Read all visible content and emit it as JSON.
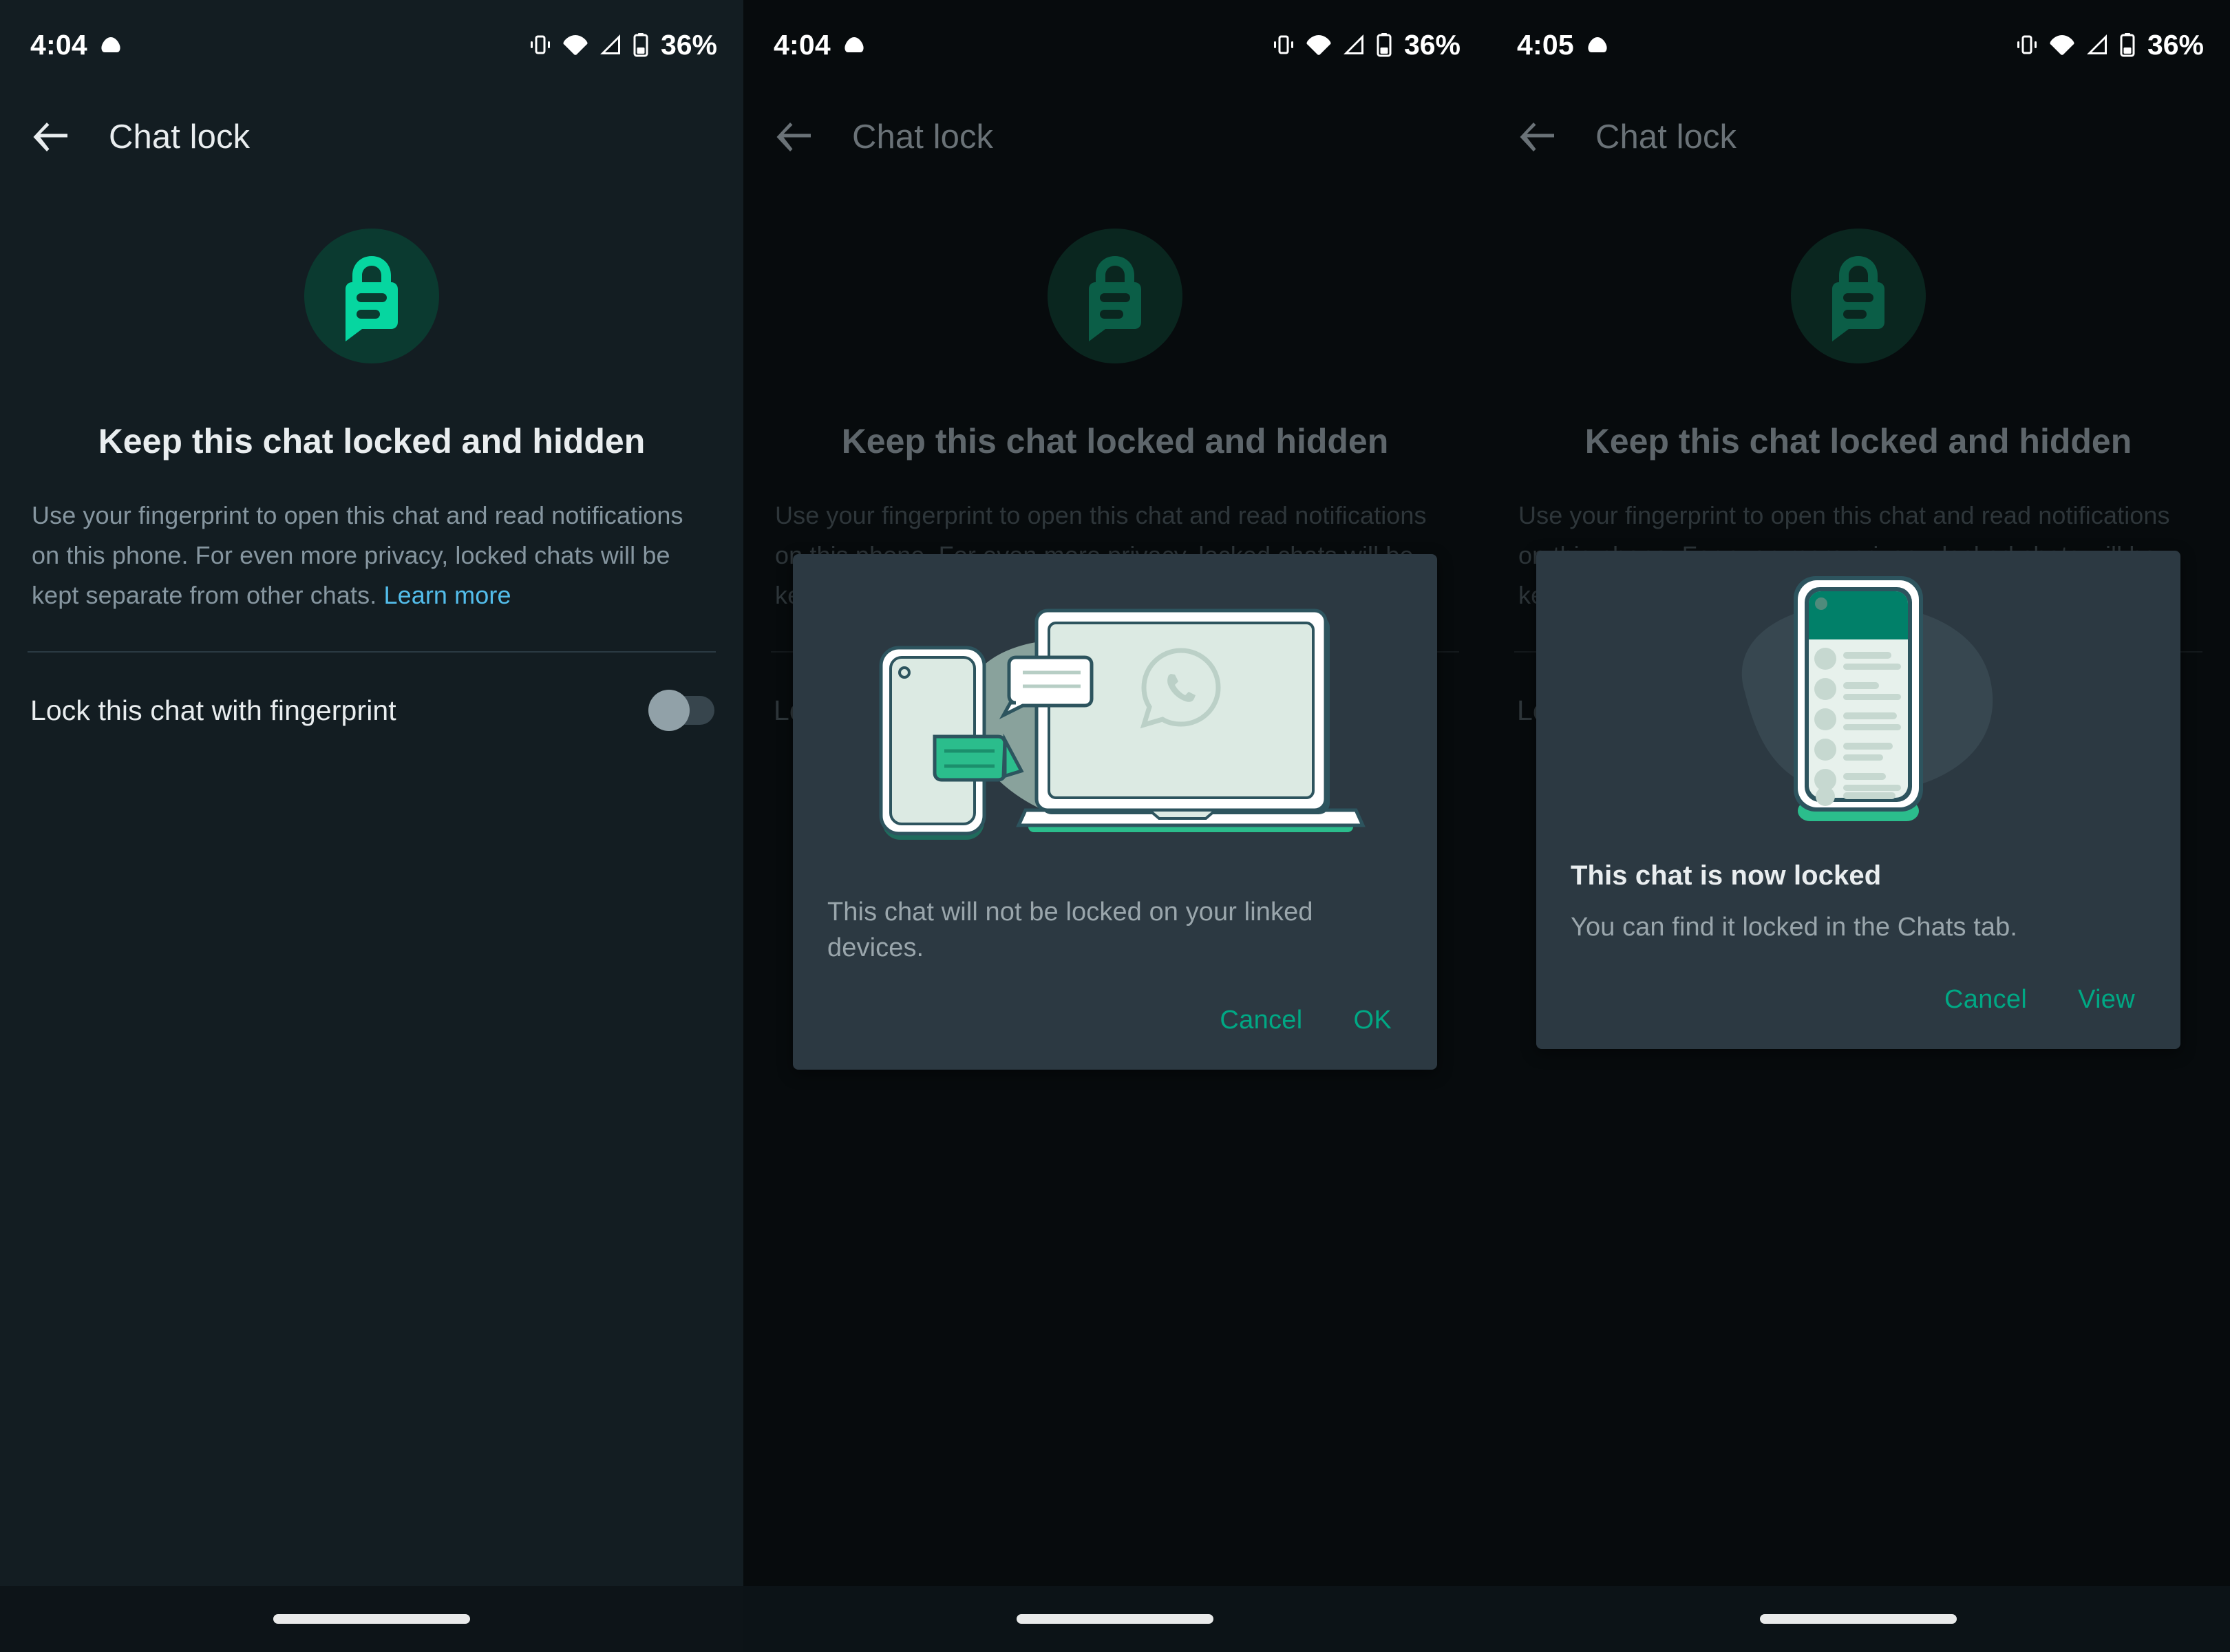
{
  "status_bar": {
    "time_p1": "4:04",
    "time_p2": "4:04",
    "time_p3": "4:05",
    "battery_percent": "36%",
    "icons": [
      "cloud-icon",
      "vibrate-icon",
      "wifi-icon",
      "signal-icon",
      "battery-icon"
    ]
  },
  "app_bar": {
    "title": "Chat lock",
    "back_icon": "back-arrow-icon"
  },
  "screen": {
    "hero_icon": "chat-lock-icon",
    "headline": "Keep this chat locked and hidden",
    "body_text": "Use your fingerprint to open this chat and read notifications on this phone. For even more privacy, locked chats will be kept separate from other chats. ",
    "learn_more": "Learn more",
    "setting_label": "Lock this chat with fingerprint",
    "setting_state": "off"
  },
  "dialog_linked_devices": {
    "illustration": "phone-and-laptop-illustration",
    "message": "This chat will not be locked on your linked devices.",
    "cancel_label": "Cancel",
    "confirm_label": "OK"
  },
  "dialog_locked_confirm": {
    "illustration": "phone-chat-list-illustration",
    "title": "This chat is now locked",
    "message": "You can find it locked in the Chats tab.",
    "cancel_label": "Cancel",
    "confirm_label": "View"
  },
  "nav_bar": {
    "home_indicator": "home-indicator-pill"
  },
  "colors": {
    "accent_green": "#00A884",
    "lock_green": "#06D6A0",
    "link_blue": "#53BDEB",
    "panel_bg": "#131D22",
    "dimmed_bg": "#070B0D",
    "dialog_bg": "#2C3942",
    "primary_text": "#E9EDEF",
    "secondary_text": "#8696A0"
  }
}
